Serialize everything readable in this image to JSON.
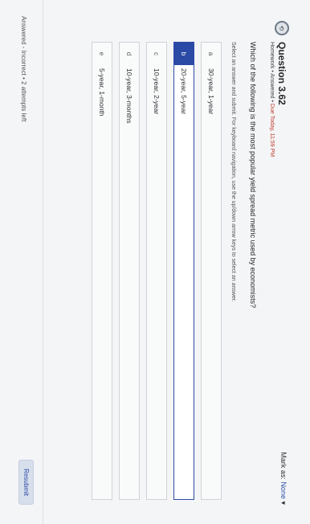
{
  "question": {
    "icon_text": "⟲",
    "title": "Question 3.62",
    "meta": {
      "type": "Homework",
      "sep1": "•",
      "status": "Answered",
      "sep2": "•",
      "due": "Due Today, 11:59 PM"
    },
    "text": "Which of the following is the most popular yield spread metric used by economists?",
    "instructions": "Select an answer and submit. For keyboard navigation, use the up/down arrow keys to select an answer."
  },
  "mark_as": {
    "label": "Mark as:",
    "value": "None",
    "chevron": "▾"
  },
  "options": [
    {
      "letter": "a",
      "text": "30-year, 1-year",
      "selected": false
    },
    {
      "letter": "b",
      "text": "20-year, 5-year",
      "selected": true
    },
    {
      "letter": "c",
      "text": "10-year, 2-year",
      "selected": false
    },
    {
      "letter": "d",
      "text": "10-year, 3-months",
      "selected": false
    },
    {
      "letter": "e",
      "text": "5-year, 1-month",
      "selected": false
    }
  ],
  "footer": {
    "status": "Answered - Incorrect • 2 attempts left",
    "resubmit_label": "Resubmit"
  },
  "colors": {
    "accent": "#2b4aa6",
    "due": "#c0392b"
  }
}
